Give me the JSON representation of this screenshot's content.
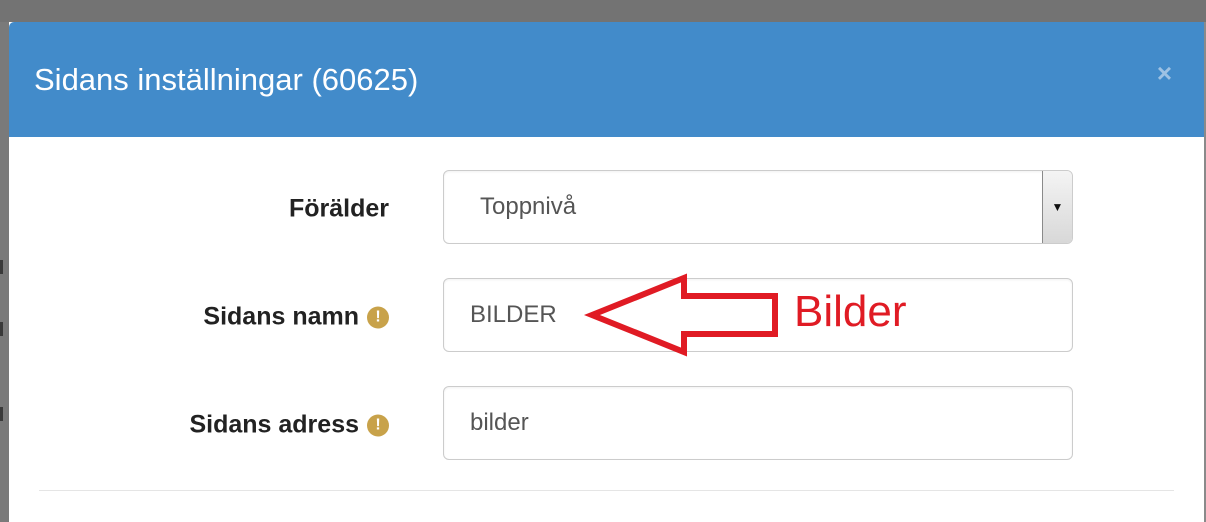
{
  "modal": {
    "title": "Sidans inställningar (60625)",
    "close_label": "×",
    "header_color": "#428bca"
  },
  "form": {
    "parent": {
      "label": "Förälder",
      "selected": "Toppnivå",
      "arrow_glyph": "▼"
    },
    "page_name": {
      "label": "Sidans namn",
      "value": "BILDER",
      "info_icon": "exclamation-circle-icon",
      "info_glyph": "!"
    },
    "page_address": {
      "label": "Sidans adress",
      "value": "bilder",
      "info_icon": "exclamation-circle-icon",
      "info_glyph": "!"
    }
  },
  "annotation": {
    "text": "Bilder",
    "color": "#e01b24"
  }
}
